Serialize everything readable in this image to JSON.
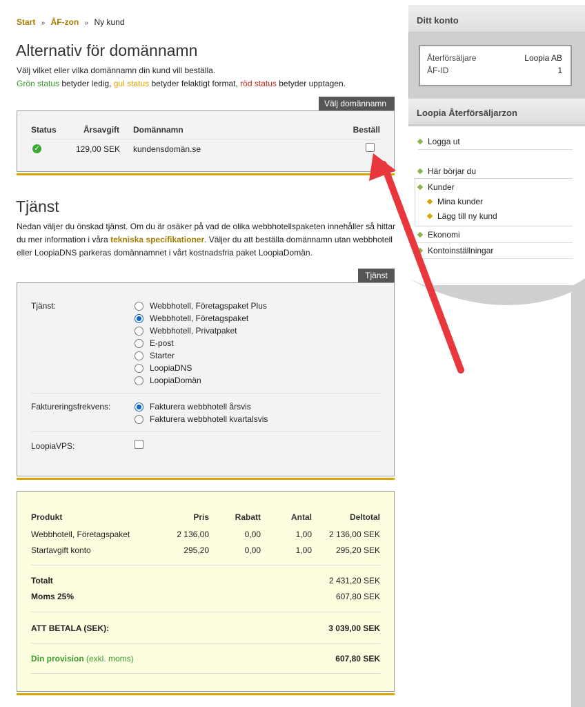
{
  "breadcrumb": {
    "start": "Start",
    "zone": "ÅF-zon",
    "current": "Ny kund",
    "sep": "»"
  },
  "domains": {
    "title": "Alternativ för domännamn",
    "intro_line1": "Välj vilket eller vilka domännamn din kund vill beställa.",
    "green": "Grön status",
    "green_rest": " betyder ledig, ",
    "yellow": "gul status",
    "yellow_rest": " betyder felaktigt format, ",
    "red": "röd status",
    "red_rest": " betyder upptagen.",
    "tab": "Välj domännamn",
    "headers": {
      "status": "Status",
      "fee": "Årsavgift",
      "name": "Domännamn",
      "order": "Beställ"
    },
    "row": {
      "status": "ok",
      "fee": "129,00 SEK",
      "name": "kundensdomän.se",
      "order_checked": false
    }
  },
  "service": {
    "title": "Tjänst",
    "intro_a": "Nedan väljer du önskad tjänst. Om du är osäker på vad de olika webbhotellspaketen innehåller så hittar du mer information i våra ",
    "intro_link": "tekniska specifikationer",
    "intro_b": ". Väljer du att beställa domännamn utan webbhotell eller LoopiaDNS parkeras domännamnet i vårt kostnadsfria paket LoopiaDomän.",
    "tab": "Tjänst",
    "service_label": "Tjänst:",
    "options": [
      "Webbhotell, Företagspaket Plus",
      "Webbhotell, Företagspaket",
      "Webbhotell, Privatpaket",
      "E-post",
      "Starter",
      "LoopiaDNS",
      "LoopiaDomän"
    ],
    "selected": "Webbhotell, Företagspaket",
    "billing_label": "Faktureringsfrekvens:",
    "billing_options": [
      "Fakturera webbhotell årsvis",
      "Fakturera webbhotell kvartalsvis"
    ],
    "billing_selected": "Fakturera webbhotell årsvis",
    "vps_label": "LoopiaVPS:",
    "vps_checked": false
  },
  "summary": {
    "headers": {
      "product": "Produkt",
      "price": "Pris",
      "discount": "Rabatt",
      "qty": "Antal",
      "subtotal": "Deltotal"
    },
    "rows": [
      {
        "product": "Webbhotell, Företagspaket",
        "price": "2 136,00",
        "discount": "0,00",
        "qty": "1,00",
        "subtotal": "2 136,00 SEK"
      },
      {
        "product": "Startavgift konto",
        "price": "295,20",
        "discount": "0,00",
        "qty": "1,00",
        "subtotal": "295,20 SEK"
      }
    ],
    "total_label": "Totalt",
    "total": "2 431,20 SEK",
    "vat_label": "Moms 25%",
    "vat": "607,80 SEK",
    "pay_label": "ATT BETALA (SEK):",
    "pay": "3 039,00 SEK",
    "commission_label": "Din provision",
    "commission_note": " (exkl. moms)",
    "commission": "607,80 SEK"
  },
  "sidebar": {
    "account_title": "Ditt konto",
    "reseller_label": "Återförsäljare",
    "reseller": "Loopia AB",
    "id_label": "ÅF-ID",
    "id": "1",
    "zone_title": "Loopia Återförsäljarzon",
    "logout": "Logga ut",
    "start_here": "Här börjar du",
    "customers": "Kunder",
    "my_customers": "Mina kunder",
    "add_customer": "Lägg till ny kund",
    "economy": "Ekonomi",
    "settings": "Kontoinställningar"
  },
  "colors": {
    "gold": "#a57d00",
    "green": "#3a9a2c",
    "yellow": "#e0a200",
    "red": "#c0281e",
    "arrow": "#e8383d"
  }
}
